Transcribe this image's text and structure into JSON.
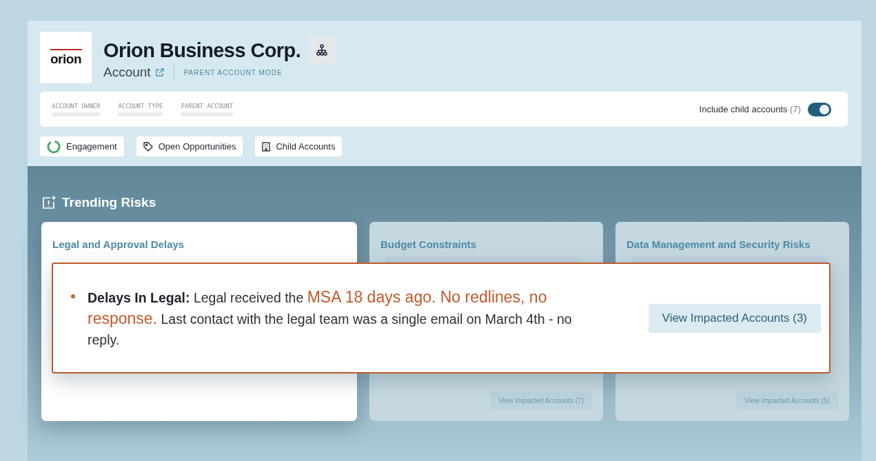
{
  "account": {
    "logo_text": "orion",
    "name": "Orion Business Corp.",
    "type_label": "Account",
    "mode": "PARENT ACCOUNT MODE"
  },
  "info": {
    "fields": [
      {
        "label": "ACCOUNT OWNER"
      },
      {
        "label": "ACCOUNT TYPE"
      },
      {
        "label": "PARENT ACCOUNT"
      }
    ],
    "toggle": {
      "label": "Include child accounts",
      "count": "(7)",
      "on": true
    }
  },
  "tabs": [
    {
      "label": "Engagement",
      "kind": "ring"
    },
    {
      "label": "Open Opportunities",
      "kind": "tag"
    },
    {
      "label": "Child Accounts",
      "kind": "building"
    }
  ],
  "risks": {
    "title": "Trending Risks",
    "cards": [
      {
        "title": "Legal and Approval Delays",
        "highlighted": true
      },
      {
        "title": "Budget Constraints",
        "highlighted": false,
        "button": "View Impacted Accounts (7)"
      },
      {
        "title": "Data Management and Security Risks",
        "highlighted": false,
        "button": "View Impacted Accounts (5)"
      }
    ],
    "popup": {
      "segments": [
        {
          "kind": "label",
          "text": "Delays In Legal:"
        },
        {
          "kind": "plain",
          "text": "Legal received the"
        },
        {
          "kind": "highlight",
          "text": "MSA 18 days ago. No redlines, no response."
        },
        {
          "kind": "plain",
          "text": "Last contact with the legal team was a single email on March 4th - no reply."
        }
      ],
      "button": "View Impacted Accounts (3)"
    }
  }
}
